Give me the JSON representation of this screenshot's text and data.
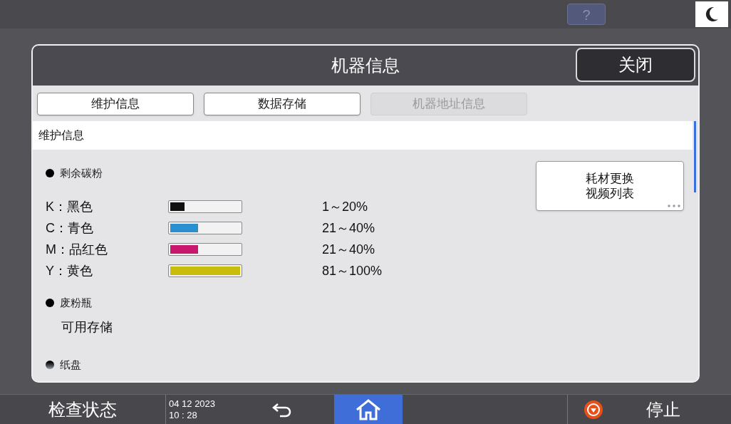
{
  "top_bar": {
    "help_label": "?"
  },
  "dialog": {
    "title": "机器信息",
    "close_label": "关闭",
    "tabs": [
      {
        "label": "维护信息",
        "disabled": false
      },
      {
        "label": "数据存储",
        "disabled": false
      },
      {
        "label": "机器地址信息",
        "disabled": true
      }
    ],
    "section_title": "维护信息",
    "toner_heading": "剩余碳粉",
    "toners": [
      {
        "label": "K：黑色",
        "level": 0.2,
        "color": "#111111",
        "reading": "1～20%"
      },
      {
        "label": "C：青色",
        "level": 0.4,
        "color": "#2a8fd0",
        "reading": "21～40%"
      },
      {
        "label": "M：品红色",
        "level": 0.4,
        "color": "#c8186e",
        "reading": "21～40%"
      },
      {
        "label": "Y：黄色",
        "level": 1,
        "color": "#c9bc0a",
        "reading": "81～100%"
      }
    ],
    "waste_heading": "废粉瓶",
    "waste_status": "可用存储",
    "tray_heading": "纸盘",
    "video_button": [
      "耗材更换",
      "视频列表"
    ]
  },
  "bottom_bar": {
    "status_label": "检查状态",
    "date": "04 12 2023",
    "time": "10 : 28",
    "home_selected": true,
    "stop_label": "停止"
  }
}
